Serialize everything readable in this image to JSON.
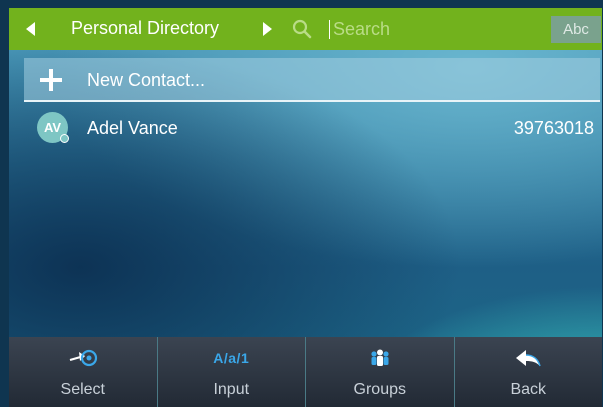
{
  "header": {
    "title": "Personal Directory",
    "search_placeholder": "Search",
    "search_value": "",
    "input_mode_label": "Abc"
  },
  "list": {
    "new_contact_label": "New Contact...",
    "contacts": [
      {
        "initials": "AV",
        "name": "Adel Vance",
        "number": "39763018"
      }
    ]
  },
  "softkeys": [
    {
      "label": "Select",
      "icon": "select-arrow-icon"
    },
    {
      "label": "Input",
      "icon_text": "A/a/1",
      "icon": "input-mode-icon"
    },
    {
      "label": "Groups",
      "icon": "groups-icon"
    },
    {
      "label": "Back",
      "icon": "back-arrow-icon"
    }
  ],
  "colors": {
    "header_green": "#72b21d",
    "accent_blue": "#3aa7e9",
    "avatar_teal": "#7ec6c4"
  }
}
